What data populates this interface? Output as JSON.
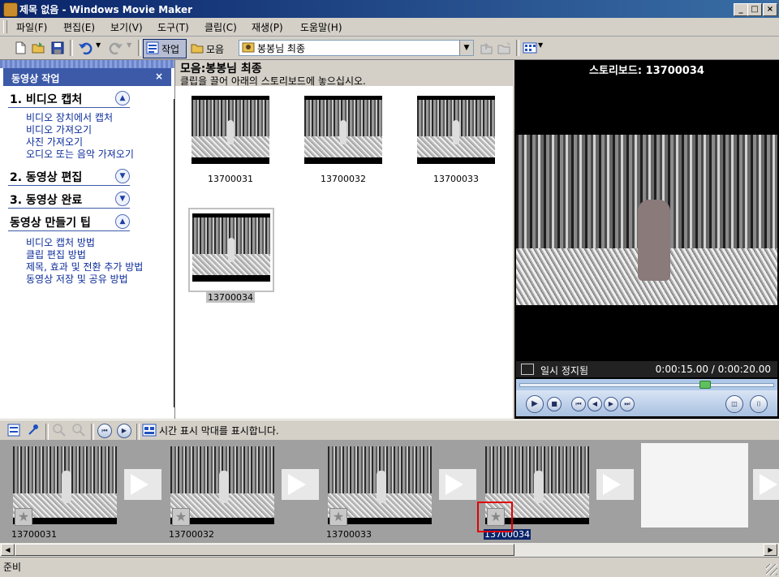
{
  "window": {
    "title": "제목 없음 - Windows Movie Maker",
    "minimize": "_",
    "maximize": "□",
    "close": "×"
  },
  "menu": [
    "파일(F)",
    "편집(E)",
    "보기(V)",
    "도구(T)",
    "클립(C)",
    "재생(P)",
    "도움말(H)"
  ],
  "toolbar": {
    "tasks_label": "작업",
    "collections_label": "모음",
    "collection_select": "봉봉님 최종"
  },
  "task_pane": {
    "header": "동영상 작업",
    "close": "×",
    "sections": [
      {
        "title": "1. 비디오 캡처",
        "expanded": true,
        "links": [
          "비디오 장치에서 캡처",
          "비디오 가져오기",
          "사진 가져오기",
          "오디오 또는 음악 가져오기"
        ]
      },
      {
        "title": "2. 동영상 편집",
        "expanded": false,
        "links": []
      },
      {
        "title": "3. 동영상 완료",
        "expanded": false,
        "links": []
      },
      {
        "title": "동영상 만들기 팁",
        "expanded": true,
        "links": [
          "비디오 캡처 방법",
          "클립 편집 방법",
          "제목, 효과 및 전환 추가 방법",
          "동영상 저장 및 공유 방법"
        ]
      }
    ]
  },
  "collection": {
    "title": "모음:봉봉님 최종",
    "subtitle": "클립을 끌어 아래의 스토리보드에 놓으십시오.",
    "clips": [
      "13700031",
      "13700032",
      "13700033",
      "13700034"
    ],
    "selected_clip": "13700034"
  },
  "preview": {
    "title": "스토리보드: 13700034",
    "status": "일시 정지됨",
    "time": "0:00:15.00 / 0:00:20.00",
    "progress": 0.75
  },
  "storyboard": {
    "hint": "시간 표시 막대를 표시합니다.",
    "clips": [
      "13700031",
      "13700032",
      "13700033",
      "13700034"
    ],
    "selected_clip": "13700034"
  },
  "status_bar": {
    "text": "준비"
  },
  "colors": {
    "title_bar": "#0a246a",
    "task_header": "#3c5aa8",
    "link": "#0b2b9a",
    "highlight": "#e00000",
    "selection": "#0a246a"
  }
}
